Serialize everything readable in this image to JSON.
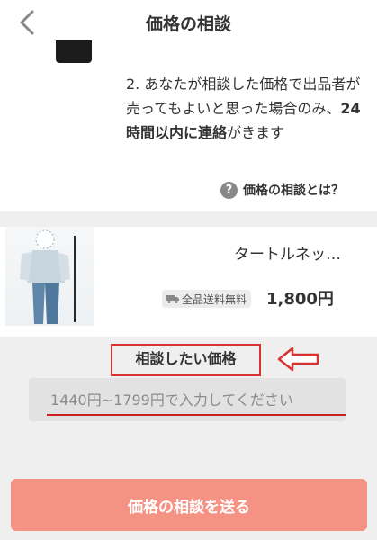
{
  "nav": {
    "title": "価格の相談",
    "back_icon": "chevron-left-icon"
  },
  "info": {
    "line_prefix": "2. あなたが相談した価格で出品者が売ってもよいと思った場合のみ、",
    "emphasis": "24時間以内に連絡",
    "line_suffix": "がきます"
  },
  "help": {
    "icon": "question-circle-icon",
    "label": "価格の相談とは？"
  },
  "product": {
    "name": "タートルネッ…",
    "shipping_badge": "全品送料無料",
    "price": "1,800円"
  },
  "offer": {
    "label": "相談したい価格",
    "placeholder": "1440円~1799円で入力してください"
  },
  "submit": {
    "label": "価格の相談を送る"
  },
  "colors": {
    "accent": "#f49283",
    "annotation_red": "#d83232",
    "background_gray": "#efefef"
  }
}
